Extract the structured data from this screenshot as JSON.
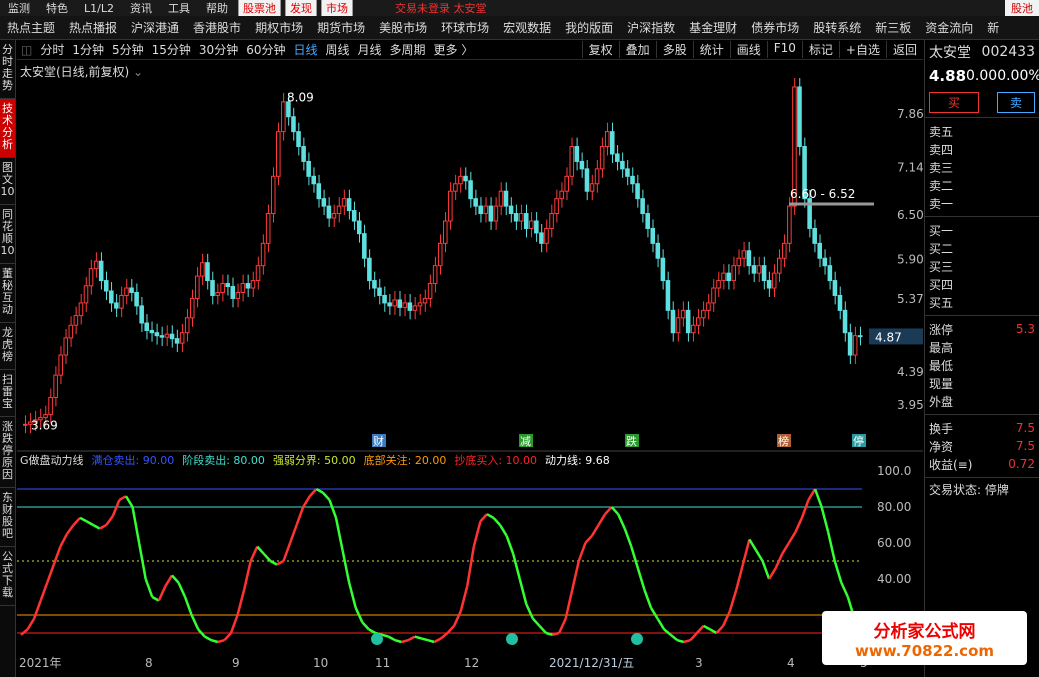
{
  "menubar": {
    "items": [
      "监测",
      "特色",
      "L1/L2",
      "资讯",
      "工具",
      "帮助"
    ],
    "stock_pool": "股票池",
    "discover": "发现",
    "market": "市场",
    "center_label": "交易未登录  太安堂",
    "gubao": "股池"
  },
  "navbar": {
    "items": [
      "热点主题",
      "热点播报",
      "沪深港通",
      "香港股市",
      "期权市场",
      "期货市场",
      "美股市场",
      "环球市场",
      "宏观数据",
      "我的版面",
      "沪深指数",
      "基金理财",
      "债券市场",
      "股转系统",
      "新三板",
      "资金流向",
      "新"
    ]
  },
  "sidebar": {
    "items": [
      "分时走势",
      "技术分析",
      "图文10",
      "同花顺10",
      "董秘互动",
      "龙虎榜",
      "扫雷宝",
      "涨跌停原因",
      "东财股吧",
      "公式下载"
    ],
    "active": 1
  },
  "toolbar": {
    "periods": [
      "分时",
      "1分钟",
      "5分钟",
      "15分钟",
      "30分钟",
      "60分钟",
      "日线",
      "周线",
      "月线",
      "多周期",
      "更多 〉"
    ],
    "active": 6,
    "right": [
      "复权",
      "叠加",
      "多股",
      "统计",
      "画线",
      "F10",
      "标记",
      "+自选",
      "返回"
    ]
  },
  "chart": {
    "title": "太安堂(日线,前复权)",
    "high_label": "8.09",
    "low_label": "3.69",
    "range_label": "6.60 - 6.52",
    "current_price_tag": "4.87",
    "price_axis": [
      "7.86",
      "7.14",
      "6.50",
      "5.90",
      "5.37",
      "4.88",
      "4.39",
      "3.95"
    ],
    "events": [
      "财",
      "减",
      "跌",
      "榜",
      "停"
    ],
    "colors": {
      "up": "#ff3b3b",
      "down": "#5fe0e0",
      "bg": "#000000"
    }
  },
  "indicator": {
    "name": "G做盘动力线",
    "items": [
      {
        "label": "满仓卖出: 90.00",
        "color": "#3355ff"
      },
      {
        "label": "阶段卖出: 80.00",
        "color": "#40e0d0"
      },
      {
        "label": "强弱分界: 50.00",
        "color": "#c8e632"
      },
      {
        "label": "底部关注: 20.00",
        "color": "#ff9900"
      },
      {
        "label": "抄底买入: 10.00",
        "color": "#ff2222"
      },
      {
        "label": "动力线: 9.68",
        "color": "#ffffff"
      }
    ],
    "axis": [
      "100.0",
      "80.00",
      "60.00",
      "40.00"
    ]
  },
  "chart_data": {
    "type": "bar",
    "series": [
      {
        "values": [
          3.69,
          3.72,
          3.75,
          3.78,
          3.82,
          4.05,
          4.35,
          4.62,
          4.85,
          5.02,
          5.15,
          5.32,
          5.55,
          5.78,
          5.88,
          5.62,
          5.48,
          5.32,
          5.25,
          5.42,
          5.52,
          5.46,
          5.28,
          5.05,
          4.95,
          4.92,
          4.88,
          4.86,
          4.9,
          4.84,
          4.78,
          4.92,
          5.12,
          5.38,
          5.68,
          5.86,
          5.62,
          5.42,
          5.46,
          5.58,
          5.54,
          5.38,
          5.46,
          5.58,
          5.52,
          5.62,
          5.82,
          6.12,
          6.52,
          7.02,
          7.62,
          8.02,
          7.82,
          7.62,
          7.42,
          7.22,
          7.02,
          6.92,
          6.72,
          6.62,
          6.46,
          6.52,
          6.62,
          6.72,
          6.56,
          6.42,
          6.25,
          5.92,
          5.62,
          5.52,
          5.42,
          5.32,
          5.28,
          5.36,
          5.26,
          5.32,
          5.22,
          5.28,
          5.32,
          5.38,
          5.58,
          5.82,
          6.12,
          6.42,
          6.82,
          6.92,
          7.02,
          6.96,
          6.72,
          6.62,
          6.52,
          6.62,
          6.42,
          6.62,
          6.82,
          6.62,
          6.52,
          6.42,
          6.52,
          6.32,
          6.42,
          6.26,
          6.12,
          6.32,
          6.52,
          6.72,
          6.82,
          7.02,
          7.42,
          7.22,
          7.12,
          6.82,
          6.92,
          7.12,
          7.42,
          7.62,
          7.32,
          7.22,
          7.12,
          7.02,
          6.92,
          6.72,
          6.52,
          6.32,
          6.12,
          5.92,
          5.62,
          5.22,
          4.92,
          5.12,
          5.22,
          4.92,
          5.02,
          5.12,
          5.22,
          5.32,
          5.52,
          5.62,
          5.72,
          5.62,
          5.82,
          5.92,
          6.02,
          5.82,
          5.72,
          5.82,
          5.62,
          5.52,
          5.72,
          5.92,
          6.12,
          6.62,
          8.22,
          7.42,
          6.72,
          6.32,
          6.12,
          5.92,
          5.82,
          5.62,
          5.42,
          5.22,
          4.92,
          4.62,
          4.88,
          4.87
        ]
      }
    ],
    "ylim": [
      3.6,
      8.3
    ],
    "xticks": [
      "2021年",
      "8",
      "9",
      "10",
      "11",
      "12",
      "2021/12/31/五",
      "3",
      "4",
      "5"
    ],
    "indicator_values": [
      9,
      12,
      18,
      28,
      38,
      48,
      58,
      65,
      70,
      74,
      72,
      70,
      68,
      70,
      75,
      84,
      86,
      80,
      60,
      40,
      30,
      28,
      36,
      42,
      38,
      30,
      20,
      12,
      8,
      6,
      5,
      6,
      10,
      20,
      34,
      50,
      58,
      54,
      50,
      48,
      50,
      60,
      70,
      80,
      86,
      90,
      88,
      84,
      74,
      56,
      38,
      24,
      16,
      12,
      10,
      9,
      8,
      6,
      5,
      6,
      8,
      7,
      6,
      5,
      7,
      10,
      14,
      22,
      36,
      58,
      72,
      76,
      74,
      70,
      64,
      54,
      40,
      26,
      18,
      14,
      10,
      9,
      10,
      18,
      34,
      50,
      60,
      64,
      70,
      76,
      80,
      76,
      68,
      58,
      46,
      34,
      24,
      18,
      12,
      9,
      6,
      5,
      6,
      10,
      14,
      12,
      10,
      14,
      22,
      34,
      48,
      62,
      56,
      50,
      40,
      46,
      54,
      60,
      66,
      74,
      84,
      90,
      80,
      66,
      50,
      38,
      30,
      18
    ]
  },
  "right_panel": {
    "name": "太安堂",
    "code": "002433",
    "price": "4.88",
    "chg": "0.00",
    "pct": "0.00%",
    "buy": "买",
    "sell": "卖",
    "asks": [
      "卖五",
      "卖四",
      "卖三",
      "卖二",
      "卖一"
    ],
    "bids": [
      "买一",
      "买二",
      "买三",
      "买四",
      "买五"
    ],
    "stats": [
      {
        "label": "涨停",
        "value": "5.3"
      },
      {
        "label": "最高",
        "value": ""
      },
      {
        "label": "最低",
        "value": ""
      },
      {
        "label": "现量",
        "value": ""
      },
      {
        "label": "外盘",
        "value": ""
      }
    ],
    "stats2": [
      {
        "label": "换手",
        "value": "7.5"
      },
      {
        "label": "净资",
        "value": "7.5"
      },
      {
        "label": "收益(≡)",
        "value": "0.72"
      }
    ],
    "trade_status_label": "交易状态:",
    "trade_status_value": "停牌"
  },
  "logo": {
    "line1": "分析家公式网",
    "line2": "www.70822.com"
  }
}
